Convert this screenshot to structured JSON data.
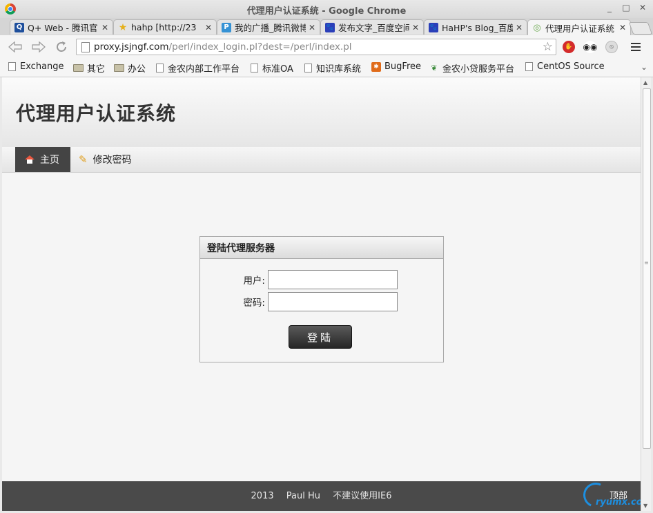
{
  "window": {
    "title": "代理用户认证系统 - Google Chrome",
    "controls": [
      "_",
      "□",
      "✕"
    ]
  },
  "tabs": [
    {
      "label": "Q+ Web - 腾讯官",
      "icon": "Q",
      "color": "#1e4f9c"
    },
    {
      "label": "hahp [http://23",
      "icon": "★",
      "color": "#e5b01a"
    },
    {
      "label": "我的广播_腾讯微博",
      "icon": "P",
      "color": "#3592d5"
    },
    {
      "label": "发布文字_百度空间",
      "icon": "🐾",
      "color": "#2b3fb9"
    },
    {
      "label": "HaHP's Blog_百度",
      "icon": "🐾",
      "color": "#2b3fb9"
    },
    {
      "label": "代理用户认证系统",
      "icon": "◎",
      "color": "#6aa84f"
    }
  ],
  "tab_close": "✕",
  "toolbar": {
    "url_host": "proxy.jsjngf.com",
    "url_path": "/perl/index_login.pl?dest=/perl/index.pl"
  },
  "bookmarks": [
    {
      "label": "Exchange",
      "kind": "page"
    },
    {
      "label": "其它",
      "kind": "folder"
    },
    {
      "label": "办公",
      "kind": "folder"
    },
    {
      "label": "金农内部工作平台",
      "kind": "page"
    },
    {
      "label": "标准OA",
      "kind": "page"
    },
    {
      "label": "知识库系统",
      "kind": "page"
    },
    {
      "label": "BugFree",
      "kind": "bug"
    },
    {
      "label": "金农小贷服务平台",
      "kind": "leaf"
    },
    {
      "label": "CentOS Source",
      "kind": "page"
    }
  ],
  "site": {
    "title": "代理用户认证系统",
    "nav": {
      "home": "主页",
      "change_password": "修改密码"
    }
  },
  "login": {
    "heading": "登陆代理服务器",
    "user_label": "用户:",
    "password_label": "密码:",
    "user_value": "",
    "password_value": "",
    "submit": "登陆"
  },
  "footer": {
    "year": "2013",
    "author": "Paul Hu",
    "note": "不建议使用IE6",
    "top_link": "顶部"
  },
  "watermark": "ryumx.com"
}
